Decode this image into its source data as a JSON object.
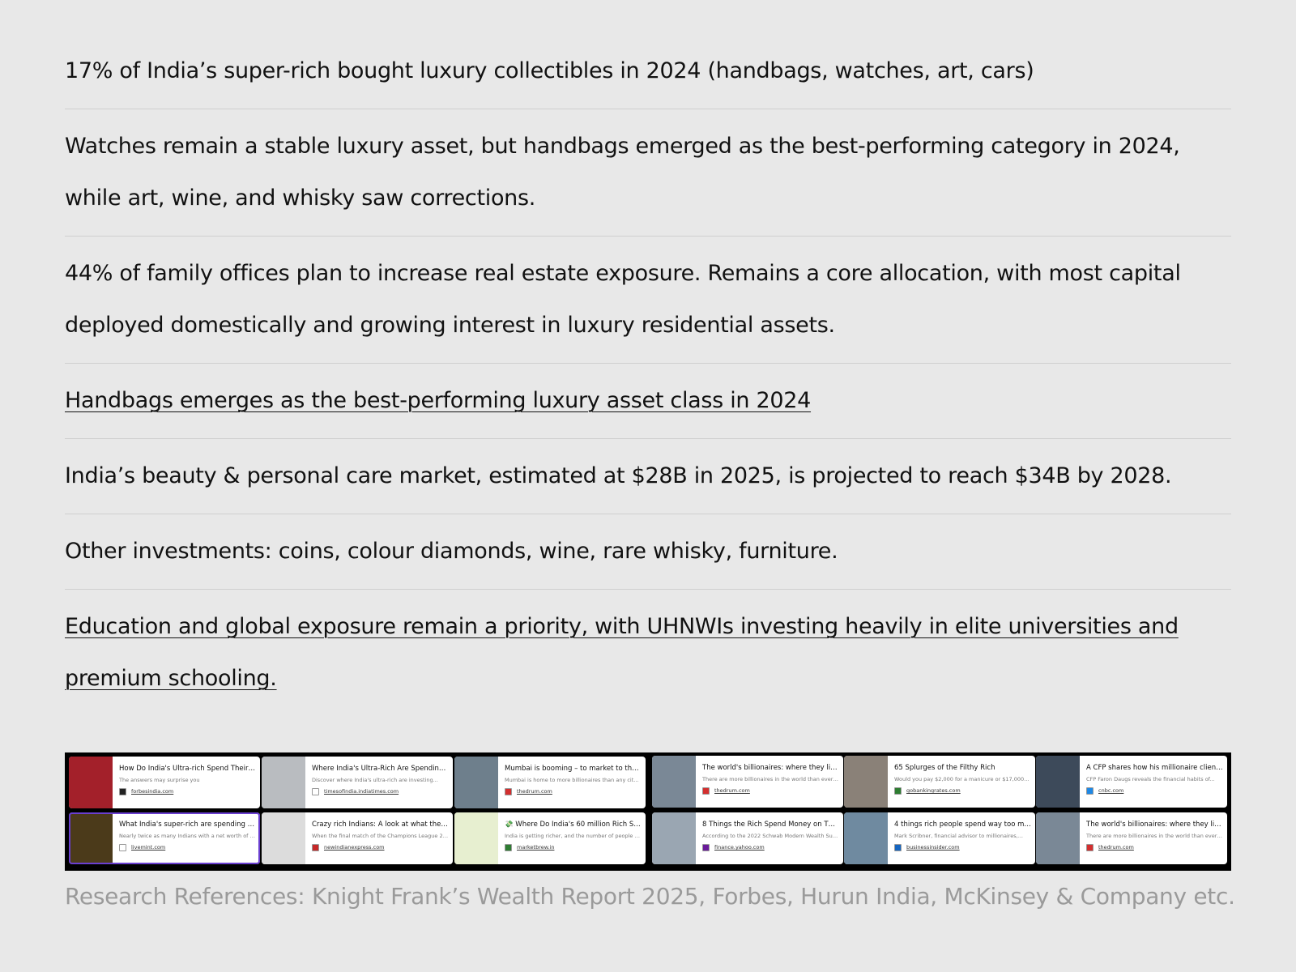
{
  "rows": [
    {
      "text": "17% of India’s super-rich bought luxury collectibles in 2024 (handbags, watches, art, cars)",
      "link": false
    },
    {
      "text": "Watches remain a stable luxury asset, but handbags emerged as the best-performing category in 2024, while art, wine, and whisky saw corrections.",
      "link": false
    },
    {
      "text": "44% of family offices plan to increase real estate exposure. Remains a core allocation, with most capital deployed domestically and growing interest in luxury residential assets.",
      "link": false
    },
    {
      "text": "Handbags emerges as the best-performing luxury asset class in 2024",
      "link": true
    },
    {
      "text": "India’s beauty & personal care market, estimated at $28B in 2025, is projected to reach $34B by 2028.",
      "link": false
    },
    {
      "text": "Other investments: coins, colour diamonds, wine, rare whisky, furniture.",
      "link": false
    },
    {
      "text": "Education and global exposure remain a priority, with UHNWIs investing heavily in elite universities and premium schooling.",
      "link": true
    }
  ],
  "cards": [
    {
      "title": "How Do India's Ultra-rich Spend Their Billio...",
      "desc": "The answers may surprise you",
      "source": "forbesindia.com",
      "fav_color": "#222222",
      "thumb_color": "#a3202a",
      "selected": false
    },
    {
      "title": "Where India's Ultra-Rich Are Spending...",
      "desc": "Discover where India's ultra-rich are investing...",
      "source": "timesofindia.indiatimes.com",
      "fav_color": "#ffffff",
      "thumb_color": "#b9bcc0",
      "selected": false
    },
    {
      "title": "Mumbai is booming – to market to the...",
      "desc": "Mumbai is home to more billionaires than any city e...",
      "source": "thedrum.com",
      "fav_color": "#d32f2f",
      "thumb_color": "#6e7f8c",
      "selected": false
    },
    {
      "title": "The world's billionaires: where they live...",
      "desc": "There are more billionaires in the world than ever b...",
      "source": "thedrum.com",
      "fav_color": "#d32f2f",
      "thumb_color": "#7a8896",
      "selected": false
    },
    {
      "title": "65 Splurges of the Filthy Rich",
      "desc": "Would you pay $2,000 for a manicure or $17,000...",
      "source": "gobankingrates.com",
      "fav_color": "#2e7d32",
      "thumb_color": "#8a8178",
      "selected": false
    },
    {
      "title": "A CFP shares how his millionaire clients sp...",
      "desc": "CFP Faron Daugs reveals the financial habits of...",
      "source": "cnbc.com",
      "fav_color": "#1e88e5",
      "thumb_color": "#3d4a5a",
      "selected": false
    },
    {
      "title": "What India's super-rich are spending on | T...",
      "desc": "Nearly twice as many Indians with a net worth of m...",
      "source": "livemint.com",
      "fav_color": "#ffffff",
      "thumb_color": "#4b3a1a",
      "selected": true
    },
    {
      "title": "Crazy rich Indians: A look at what they splu...",
      "desc": "When the final match of the Champions League 20...",
      "source": "newindianexpress.com",
      "fav_color": "#c62828",
      "thumb_color": "#dcdcdc",
      "selected": false
    },
    {
      "title": "💸 Where Do India's 60 million Rich Spend?",
      "desc": "India is getting richer, and the number of people ea...",
      "source": "marketbrew.in",
      "fav_color": "#2e7d32",
      "thumb_color": "#e7efd0",
      "selected": false
    },
    {
      "title": "8 Things the Rich Spend Money on That Po...",
      "desc": "According to the 2022 Schwab Modern Wealth Sur...",
      "source": "finance.yahoo.com",
      "fav_color": "#6a1b9a",
      "thumb_color": "#9aa6b2",
      "selected": false
    },
    {
      "title": "4 things rich people spend way too much m...",
      "desc": "Mark Scribner, financial advisor to millionaires,...",
      "source": "businessinsider.com",
      "fav_color": "#1565c0",
      "thumb_color": "#6f8aa0",
      "selected": false
    },
    {
      "title": "The world's billionaires: where they live...",
      "desc": "There are more billionaires in the world than ever b...",
      "source": "thedrum.com",
      "fav_color": "#d32f2f",
      "thumb_color": "#7a8896",
      "selected": false
    }
  ],
  "references": "Research References: Knight Frank’s Wealth Report 2025, Forbes, Hurun India, McKinsey & Company etc."
}
